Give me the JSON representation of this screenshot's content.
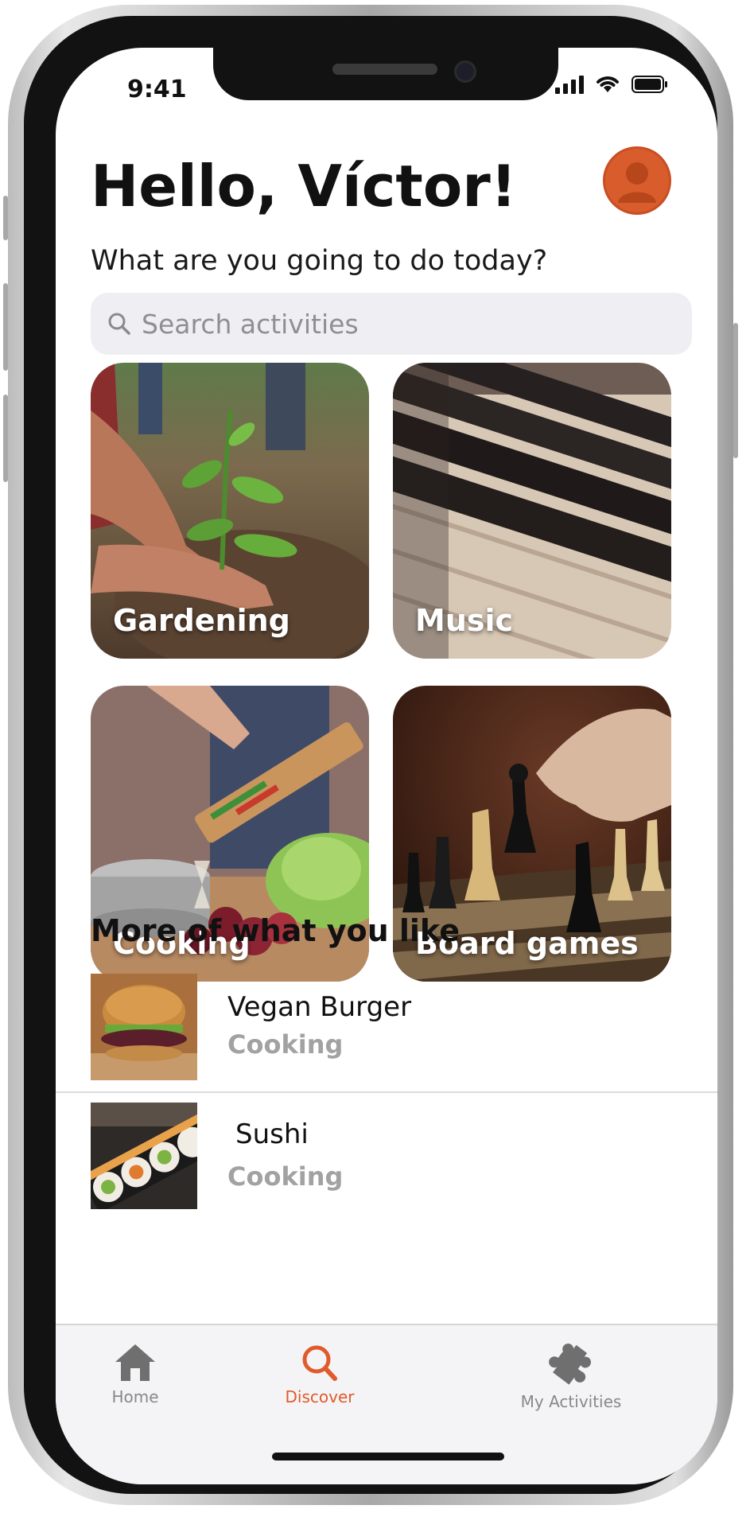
{
  "status": {
    "time": "9:41"
  },
  "header": {
    "greeting": "Hello, Víctor!",
    "subtitle": "What are you going to do today?"
  },
  "search": {
    "placeholder": "Search activities"
  },
  "categories": [
    {
      "label": "Gardening"
    },
    {
      "label": "Music"
    },
    {
      "label": "Cooking"
    },
    {
      "label": "Board games"
    }
  ],
  "recommendations": {
    "title": "More of what you like",
    "items": [
      {
        "name": "Vegan Burger",
        "category": "Cooking"
      },
      {
        "name": "Sushi",
        "category": "Cooking"
      }
    ]
  },
  "tabbar": {
    "tabs": [
      {
        "label": "Home",
        "icon": "home-icon",
        "active": false
      },
      {
        "label": "Discover",
        "icon": "search-icon",
        "active": true
      },
      {
        "label": "My Activities",
        "icon": "puzzle-icon",
        "active": false
      }
    ]
  },
  "colors": {
    "accent": "#e05a2b",
    "avatar": "#d85c2c",
    "muted": "#a2a2a2"
  }
}
